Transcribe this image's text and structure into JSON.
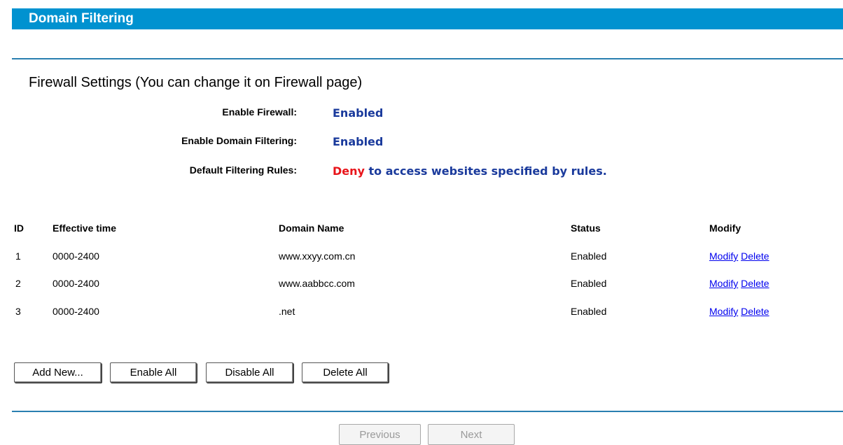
{
  "header": {
    "title": "Domain Filtering"
  },
  "firewall_settings": {
    "section_title": "Firewall Settings (You can change it on Firewall page)",
    "rows": [
      {
        "label": "Enable Firewall:",
        "value": "Enabled"
      },
      {
        "label": "Enable Domain Filtering:",
        "value": "Enabled"
      },
      {
        "label": "Default Filtering Rules:",
        "value_highlight": "Deny",
        "value": " to access websites specified by rules."
      }
    ]
  },
  "table": {
    "columns": [
      "ID",
      "Effective time",
      "Domain Name",
      "Status",
      "Modify"
    ],
    "rows": [
      {
        "id": "1",
        "time": "0000-2400",
        "domain": "www.xxyy.com.cn",
        "status": "Enabled",
        "modify": "Modify",
        "delete": "Delete"
      },
      {
        "id": "2",
        "time": "0000-2400",
        "domain": "www.aabbcc.com",
        "status": "Enabled",
        "modify": "Modify",
        "delete": "Delete"
      },
      {
        "id": "3",
        "time": "0000-2400",
        "domain": ".net",
        "status": "Enabled",
        "modify": "Modify",
        "delete": "Delete"
      }
    ]
  },
  "actions": {
    "add_new": "Add New...",
    "enable_all": "Enable All",
    "disable_all": "Disable All",
    "delete_all": "Delete All"
  },
  "pagination": {
    "previous": "Previous",
    "next": "Next"
  },
  "colors": {
    "title_bar": "#0092d0",
    "value_text": "#1a3a9c",
    "deny_text": "#e8141a",
    "link": "#0000ee"
  }
}
